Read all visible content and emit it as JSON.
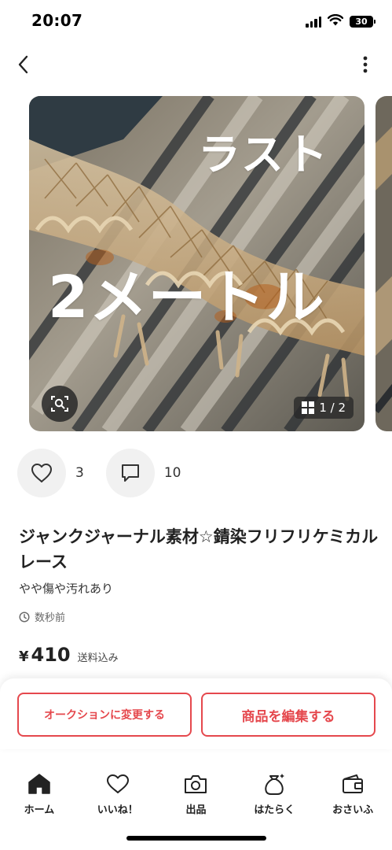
{
  "status_bar": {
    "time": "20:07",
    "battery": "30"
  },
  "nav": {
    "back_icon": "chevron-left-icon",
    "more_icon": "more-vertical-icon"
  },
  "gallery": {
    "overlay_line1": "ラスト",
    "overlay_line2": "2メートル",
    "counter": "1 / 2",
    "lens_icon": "image-search-icon"
  },
  "engagement": {
    "likes": "3",
    "comments": "10"
  },
  "item": {
    "title": "ジャンクジャーナル素材☆錆染フリフリケミカルレース",
    "condition": "やや傷や汚れあり",
    "posted": "数秒前",
    "price_symbol": "¥",
    "price": "410",
    "shipping": "送料込み"
  },
  "actions": {
    "auction_label": "オークションに変更する",
    "edit_label": "商品を編集する",
    "accent_color": "#e5484d"
  },
  "tabs": [
    {
      "label": "ホーム",
      "icon": "home-icon"
    },
    {
      "label": "いいね！",
      "icon": "heart-icon"
    },
    {
      "label": "出品",
      "icon": "camera-icon"
    },
    {
      "label": "はたらく",
      "icon": "money-bag-icon"
    },
    {
      "label": "おさいふ",
      "icon": "wallet-icon"
    }
  ]
}
